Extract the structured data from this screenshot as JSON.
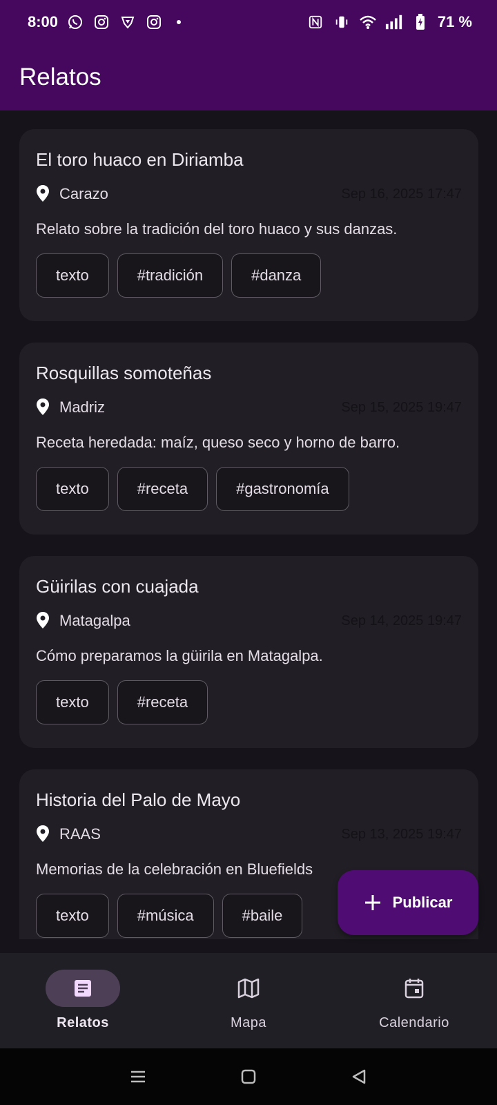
{
  "status_bar": {
    "time": "8:00",
    "battery": "71 %",
    "left_icons": [
      "whatsapp-icon",
      "instagram-icon",
      "brave-icon",
      "instagram-icon",
      "dot-icon"
    ],
    "right_icons": [
      "nfc-icon",
      "vibrate-icon",
      "wifi-icon",
      "signal-icon",
      "battery-charging-icon"
    ]
  },
  "app_bar": {
    "title": "Relatos"
  },
  "posts": [
    {
      "title": "El toro huaco en Diriamba",
      "location": "Carazo",
      "date": "Sep 16, 2025 17:47",
      "description": "Relato sobre la tradición del toro huaco y sus danzas.",
      "chips": [
        "texto",
        "#tradición",
        "#danza"
      ]
    },
    {
      "title": "Rosquillas somoteñas",
      "location": "Madriz",
      "date": "Sep 15, 2025 19:47",
      "description": "Receta heredada: maíz, queso seco y horno de barro.",
      "chips": [
        "texto",
        "#receta",
        "#gastronomía"
      ]
    },
    {
      "title": "Güirilas con cuajada",
      "location": "Matagalpa",
      "date": "Sep 14, 2025 19:47",
      "description": "Cómo preparamos la güirila en Matagalpa.",
      "chips": [
        "texto",
        "#receta"
      ]
    },
    {
      "title": "Historia del Palo de Mayo",
      "location": "RAAS",
      "date": "Sep 13, 2025 19:47",
      "description": "Memorias de la celebración en Bluefields",
      "chips": [
        "texto",
        "#música",
        "#baile"
      ]
    }
  ],
  "fab": {
    "label": "Publicar",
    "icon": "plus-icon"
  },
  "bottom_nav": {
    "items": [
      {
        "label": "Relatos",
        "icon": "article-icon",
        "active": true
      },
      {
        "label": "Mapa",
        "icon": "map-icon",
        "active": false
      },
      {
        "label": "Calendario",
        "icon": "calendar-icon",
        "active": false
      }
    ]
  },
  "colors": {
    "app_bar": "#46085e",
    "background": "#16141a",
    "card": "#211f25",
    "fab": "#4f0c72",
    "nav_active_pill": "#4d4056"
  }
}
